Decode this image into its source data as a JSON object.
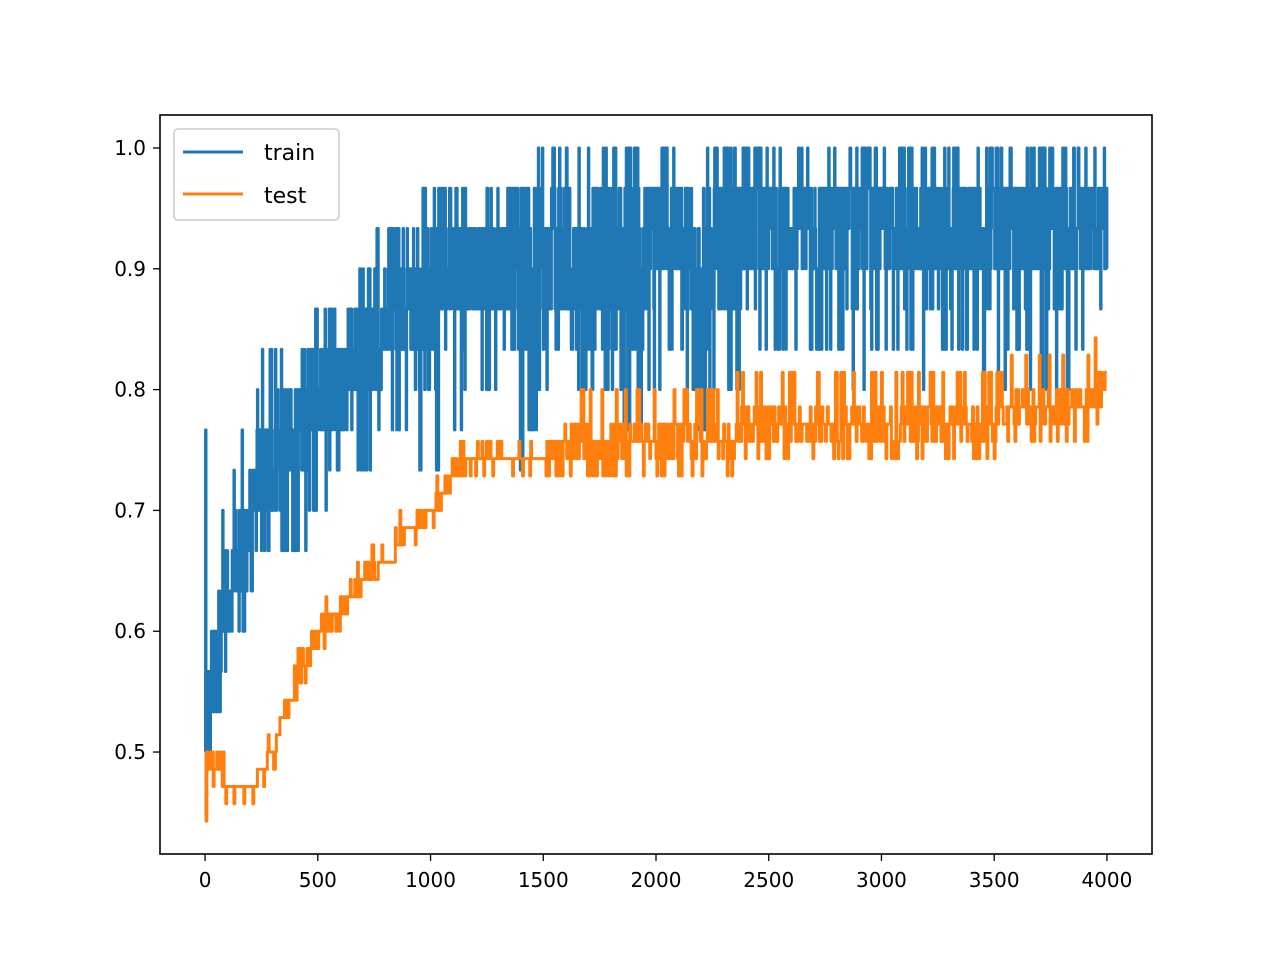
{
  "chart_data": {
    "type": "line",
    "title": "",
    "xlabel": "",
    "ylabel": "",
    "xlim": [
      -200,
      4200
    ],
    "ylim": [
      0.4156,
      1.0273
    ],
    "grid": false,
    "legend": {
      "placement": "top-left",
      "entries": [
        "train",
        "test"
      ]
    },
    "x_ticks": [
      0,
      500,
      1000,
      1500,
      2000,
      2500,
      3000,
      3500,
      4000
    ],
    "x_tick_labels": [
      "0",
      "500",
      "1000",
      "1500",
      "2000",
      "2500",
      "3000",
      "3500",
      "4000"
    ],
    "y_ticks": [
      0.5,
      0.6,
      0.7,
      0.8,
      0.9,
      1.0
    ],
    "y_tick_labels": [
      "0.5",
      "0.6",
      "0.7",
      "0.8",
      "0.9",
      "1.0"
    ],
    "colors": {
      "train": "#1f77b4",
      "test": "#ff7f0e"
    },
    "x_checkpoints": [
      0,
      100,
      200,
      300,
      400,
      500,
      600,
      700,
      800,
      900,
      1000,
      1100,
      1200,
      1300,
      1400,
      1500,
      1600,
      1700,
      1800,
      1900,
      2000,
      2100,
      2200,
      2300,
      2400,
      2500,
      2600,
      2700,
      2800,
      2900,
      3000,
      3100,
      3200,
      3300,
      3400,
      3500,
      3600,
      3700,
      3800,
      3900,
      4000
    ],
    "series": [
      {
        "name": "train",
        "note": "oscillates heavily between low and high envelope at each epoch",
        "low": [
          0.5,
          0.567,
          0.633,
          0.667,
          0.667,
          0.7,
          0.733,
          0.733,
          0.767,
          0.767,
          0.733,
          0.767,
          0.8,
          0.8,
          0.733,
          0.8,
          0.767,
          0.8,
          0.8,
          0.767,
          0.8,
          0.833,
          0.767,
          0.8,
          0.8,
          0.833,
          0.833,
          0.833,
          0.833,
          0.8,
          0.833,
          0.833,
          0.8,
          0.833,
          0.833,
          0.8,
          0.833,
          0.8,
          0.8,
          0.833,
          0.867
        ],
        "high": [
          0.767,
          0.7,
          0.8,
          0.833,
          0.8,
          0.867,
          0.867,
          0.9,
          0.933,
          0.933,
          0.967,
          0.967,
          0.967,
          0.967,
          0.967,
          1.0,
          1.0,
          1.0,
          1.0,
          1.0,
          1.0,
          1.0,
          1.0,
          1.0,
          1.0,
          1.0,
          1.0,
          1.0,
          1.0,
          1.0,
          1.0,
          1.0,
          1.0,
          1.0,
          1.0,
          1.0,
          1.0,
          1.0,
          1.0,
          1.0,
          1.0
        ],
        "typical": [
          0.5,
          0.633,
          0.7,
          0.733,
          0.767,
          0.8,
          0.8,
          0.833,
          0.867,
          0.867,
          0.867,
          0.9,
          0.9,
          0.9,
          0.9,
          0.9,
          0.9,
          0.9,
          0.9,
          0.9,
          0.933,
          0.933,
          0.9,
          0.933,
          0.933,
          0.933,
          0.933,
          0.933,
          0.933,
          0.933,
          0.933,
          0.933,
          0.933,
          0.933,
          0.933,
          0.933,
          0.933,
          0.933,
          0.933,
          0.933,
          0.933
        ]
      },
      {
        "name": "test",
        "values": [
          0.5,
          0.471,
          0.471,
          0.5,
          0.557,
          0.6,
          0.614,
          0.643,
          0.657,
          0.686,
          0.7,
          0.729,
          0.743,
          0.743,
          0.743,
          0.743,
          0.757,
          0.757,
          0.757,
          0.757,
          0.757,
          0.757,
          0.757,
          0.757,
          0.771,
          0.771,
          0.771,
          0.771,
          0.771,
          0.771,
          0.771,
          0.771,
          0.771,
          0.771,
          0.771,
          0.771,
          0.786,
          0.786,
          0.786,
          0.786,
          0.814
        ],
        "first_value_min": 0.443,
        "spread_after_1500": 0.028
      }
    ]
  }
}
